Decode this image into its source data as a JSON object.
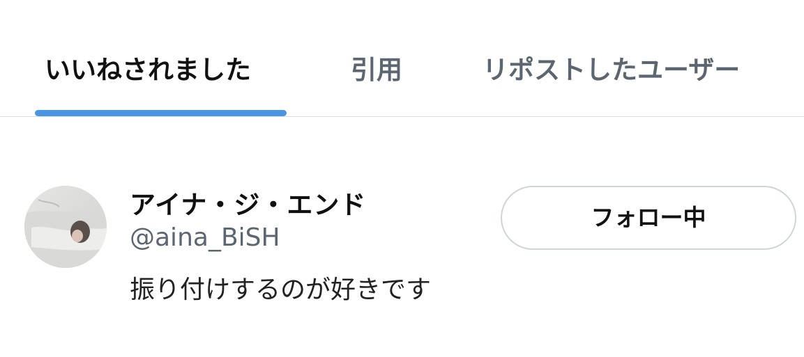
{
  "tabs": {
    "liked": {
      "label": "いいねされました",
      "active": true
    },
    "quotes": {
      "label": "引用",
      "active": false
    },
    "reposts": {
      "label": "リポストしたユーザー",
      "active": false
    }
  },
  "colors": {
    "accent": "#4a95e3",
    "active_text": "#111111",
    "muted_text": "#5b6670",
    "divider": "#d8dce0"
  },
  "user": {
    "display_name": "アイナ・ジ・エンド",
    "handle": "@aina_BiSH",
    "bio": "振り付けするのが好きです",
    "avatar_icon": "profile-photo",
    "follow_button_label": "フォロー中"
  }
}
